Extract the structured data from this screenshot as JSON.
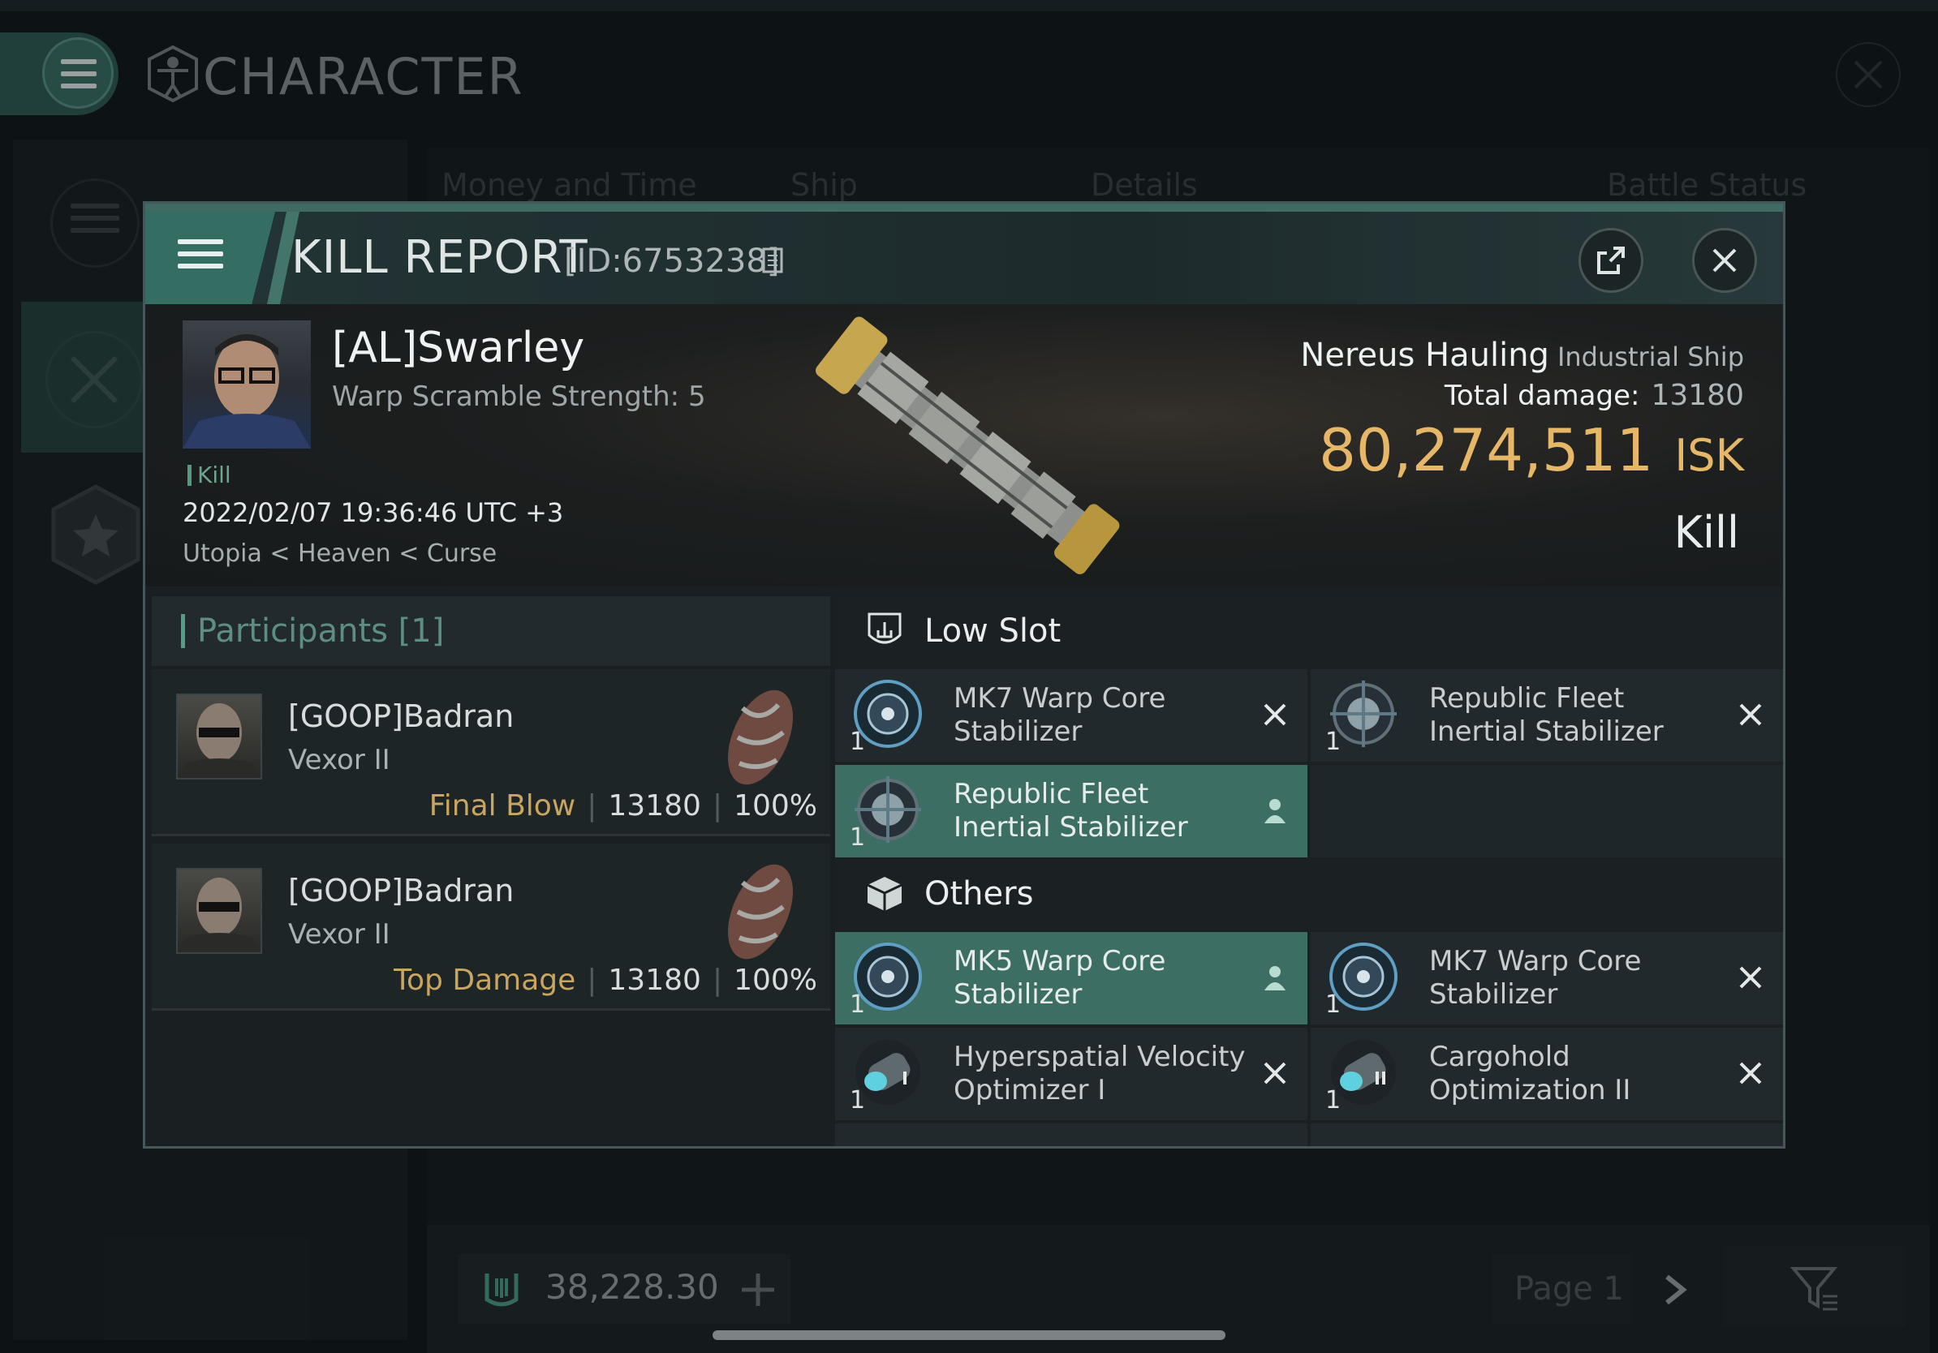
{
  "app": {
    "title": "CHARACTER",
    "columns": [
      "Money and Time",
      "Ship",
      "Details",
      "Battle Status"
    ],
    "footer": {
      "amount": "38,228.30",
      "page": "Page 1"
    }
  },
  "report": {
    "title": "KILL REPORT",
    "id": "[ID:6753238]",
    "pilot": {
      "name": "[AL]Swarley",
      "warp_scramble": "Warp Scramble Strength: 5",
      "tag": "Kill",
      "time": "2022/02/07 19:36:46 UTC +3",
      "location": "Utopia < Heaven < Curse"
    },
    "ship": {
      "name": "Nereus Hauling",
      "class": "Industrial Ship",
      "total_damage_label": "Total damage:",
      "total_damage": "13180",
      "isk_value": "80,274,511",
      "isk_unit": "ISK",
      "result": "Kill"
    },
    "participants": {
      "label": "Participants [1]",
      "rows": [
        {
          "name": "[GOOP]Badran",
          "ship": "Vexor II",
          "role": "Final Blow",
          "damage": "13180",
          "percent": "100%"
        },
        {
          "name": "[GOOP]Badran",
          "ship": "Vexor II",
          "role": "Top Damage",
          "damage": "13180",
          "percent": "100%"
        }
      ]
    },
    "low_slot": {
      "label": "Low Slot",
      "items": [
        {
          "qty": "1",
          "name": "MK7 Warp Core Stabilizer",
          "status": "destroyed",
          "icon": "warp-core-stabilizer-icon"
        },
        {
          "qty": "1",
          "name": "Republic Fleet Inertial Stabilizer",
          "status": "destroyed",
          "icon": "inertial-stabilizer-icon"
        },
        {
          "qty": "1",
          "name": "Republic Fleet Inertial Stabilizer",
          "status": "dropped",
          "icon": "inertial-stabilizer-icon"
        }
      ]
    },
    "others": {
      "label": "Others",
      "items": [
        {
          "qty": "1",
          "name": "MK5 Warp Core Stabilizer",
          "status": "dropped",
          "icon": "warp-core-stabilizer-icon"
        },
        {
          "qty": "1",
          "name": "MK7 Warp Core Stabilizer",
          "status": "destroyed",
          "icon": "warp-core-stabilizer-icon"
        },
        {
          "qty": "1",
          "name": "Hyperspatial Velocity Optimizer I",
          "status": "destroyed",
          "icon": "velocity-optimizer-icon"
        },
        {
          "qty": "1",
          "name": "Cargohold Optimization II",
          "status": "destroyed",
          "icon": "cargohold-optimization-icon"
        }
      ]
    }
  },
  "colors": {
    "accent": "#3d6e63",
    "isk": "#e7b768",
    "blow": "#c9a560"
  }
}
